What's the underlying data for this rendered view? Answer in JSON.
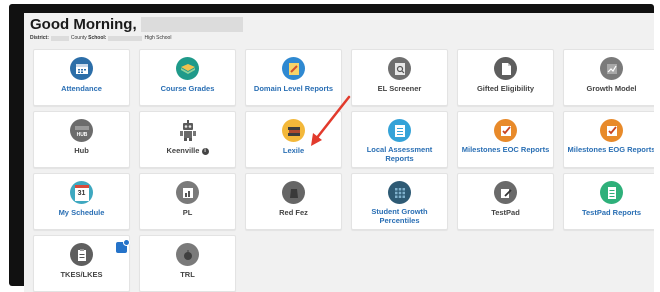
{
  "header": {
    "greeting": "Good Morning,",
    "district_label": "District:",
    "county_text": "County",
    "school_label": "School:",
    "school_suffix": "High School"
  },
  "tiles": [
    {
      "label": "Attendance",
      "icon": "calendar-icon",
      "color": "#2a6fb4"
    },
    {
      "label": "Course Grades",
      "icon": "book-icon",
      "color": "#2a6fb4"
    },
    {
      "label": "Domain Level Reports",
      "icon": "report-icon",
      "color": "#2a6fb4"
    },
    {
      "label": "EL Screener",
      "icon": "magnifier-icon",
      "color": "#444444"
    },
    {
      "label": "Gifted Eligibility",
      "icon": "document-icon",
      "color": "#444444"
    },
    {
      "label": "Growth Model",
      "icon": "growth-icon",
      "color": "#444444"
    },
    {
      "label": "Hub",
      "icon": "hub-icon",
      "color": "#444444"
    },
    {
      "label": "Keenville",
      "icon": "robot-icon",
      "color": "#444444",
      "info": "i"
    },
    {
      "label": "Lexile",
      "icon": "books-icon",
      "color": "#2a6fb4"
    },
    {
      "label": "Local Assessment Reports",
      "icon": "list-icon",
      "color": "#2a6fb4"
    },
    {
      "label": "Milestones EOC Reports",
      "icon": "checkbox-icon",
      "color": "#2a6fb4"
    },
    {
      "label": "Milestones EOG Reports",
      "icon": "checkbox-icon",
      "color": "#2a6fb4"
    },
    {
      "label": "My Schedule",
      "icon": "calendar-31-icon",
      "color": "#2a6fb4",
      "day": "31"
    },
    {
      "label": "PL",
      "icon": "chart-icon",
      "color": "#444444"
    },
    {
      "label": "Red Fez",
      "icon": "fez-icon",
      "color": "#444444"
    },
    {
      "label": "Student Growth Percentiles",
      "icon": "grid-icon",
      "color": "#2a6fb4"
    },
    {
      "label": "TestPad",
      "icon": "pencil-icon",
      "color": "#444444"
    },
    {
      "label": "TestPad Reports",
      "icon": "notepad-icon",
      "color": "#2a6fb4"
    },
    {
      "label": "TKES/LKES",
      "icon": "clipboard-icon",
      "color": "#444444"
    },
    {
      "label": "TRL",
      "icon": "apple-icon",
      "color": "#444444"
    }
  ]
}
